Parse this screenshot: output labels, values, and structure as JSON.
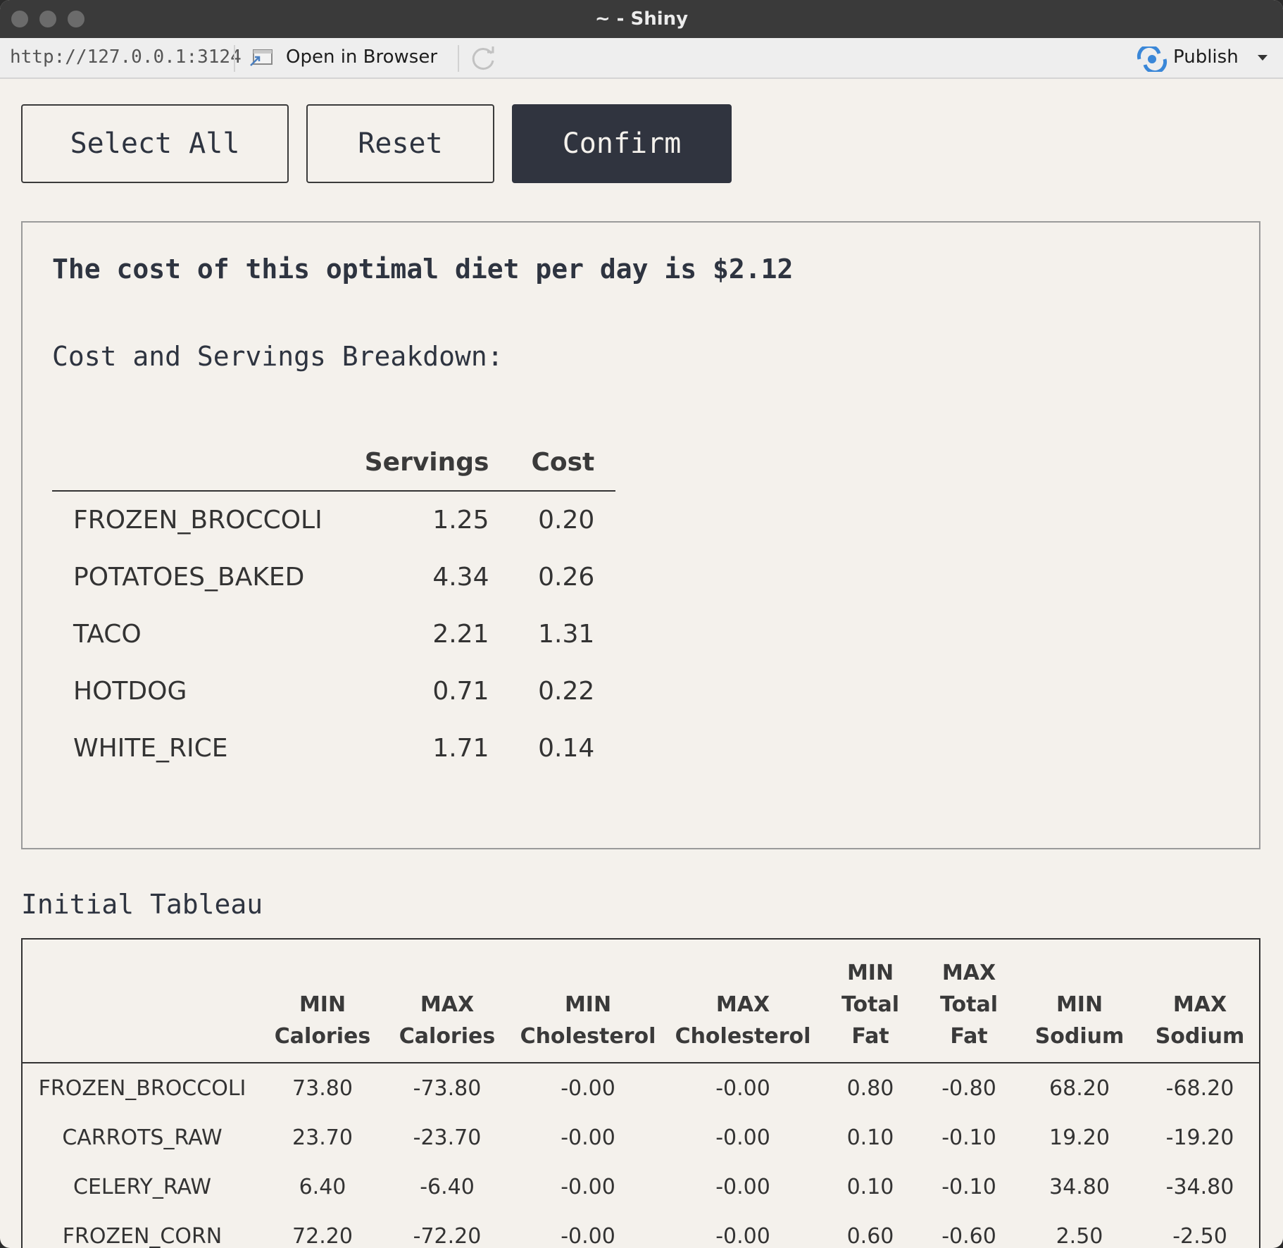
{
  "window": {
    "title": "~ - Shiny"
  },
  "toolbar": {
    "url": "http://127.0.0.1:3124",
    "open_in_browser": "Open in Browser",
    "publish": "Publish"
  },
  "buttons": {
    "select_all": "Select All",
    "reset": "Reset",
    "confirm": "Confirm"
  },
  "result": {
    "cost_line": "The cost of this optimal diet per day is $2.12",
    "breakdown_title": "Cost and Servings Breakdown:",
    "columns": [
      "",
      "Servings",
      "Cost"
    ],
    "rows": [
      {
        "name": "FROZEN_BROCCOLI",
        "servings": "1.25",
        "cost": "0.20"
      },
      {
        "name": "POTATOES_BAKED",
        "servings": "4.34",
        "cost": "0.26"
      },
      {
        "name": "TACO",
        "servings": "2.21",
        "cost": "1.31"
      },
      {
        "name": "HOTDOG",
        "servings": "0.71",
        "cost": "0.22"
      },
      {
        "name": "WHITE_RICE",
        "servings": "1.71",
        "cost": "0.14"
      }
    ]
  },
  "tableau": {
    "title": "Initial Tableau",
    "headers": [
      [
        "MIN",
        "Calories"
      ],
      [
        "MAX",
        "Calories"
      ],
      [
        "MIN",
        "Cholesterol"
      ],
      [
        "MAX",
        "Cholesterol"
      ],
      [
        "MIN",
        "Total",
        "Fat"
      ],
      [
        "MAX",
        "Total",
        "Fat"
      ],
      [
        "MIN",
        "Sodium"
      ],
      [
        "MAX",
        "Sodium"
      ]
    ],
    "rows": [
      {
        "name": "FROZEN_BROCCOLI",
        "values": [
          "73.80",
          "-73.80",
          "-0.00",
          "-0.00",
          "0.80",
          "-0.80",
          "68.20",
          "-68.20"
        ]
      },
      {
        "name": "CARROTS_RAW",
        "values": [
          "23.70",
          "-23.70",
          "-0.00",
          "-0.00",
          "0.10",
          "-0.10",
          "19.20",
          "-19.20"
        ]
      },
      {
        "name": "CELERY_RAW",
        "values": [
          "6.40",
          "-6.40",
          "-0.00",
          "-0.00",
          "0.10",
          "-0.10",
          "34.80",
          "-34.80"
        ]
      },
      {
        "name": "FROZEN_CORN",
        "values": [
          "72.20",
          "-72.20",
          "-0.00",
          "-0.00",
          "0.60",
          "-0.60",
          "2.50",
          "-2.50"
        ]
      }
    ]
  }
}
